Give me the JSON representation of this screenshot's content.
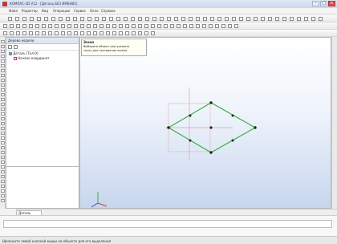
{
  "window": {
    "title": "КОМПАС-3D V12 - [Деталь БЕЗ ИМЕНИ1]",
    "min_label": "–",
    "max_label": "□",
    "close_label": "×"
  },
  "menu": [
    "Файл",
    "Редактор",
    "Вид",
    "Операции",
    "Сервис",
    "Окно",
    "Справка"
  ],
  "tree": {
    "header": "Дерево модели",
    "root": "Деталь (Тел-0)",
    "child": "Начало координат"
  },
  "tooltip": {
    "title": "Эскиз",
    "lines": [
      "Выберите объект или укажите",
      "точку для построения эскиза"
    ]
  },
  "bottom_tab": "Деталь",
  "status_text": "Щелкните левой кнопкой мыши на объекте для его выделения",
  "colors": {
    "accent": "#3a8a3a",
    "sketch_line": "#3cb043",
    "construction": "#e8a0a0",
    "point": "#222222"
  }
}
